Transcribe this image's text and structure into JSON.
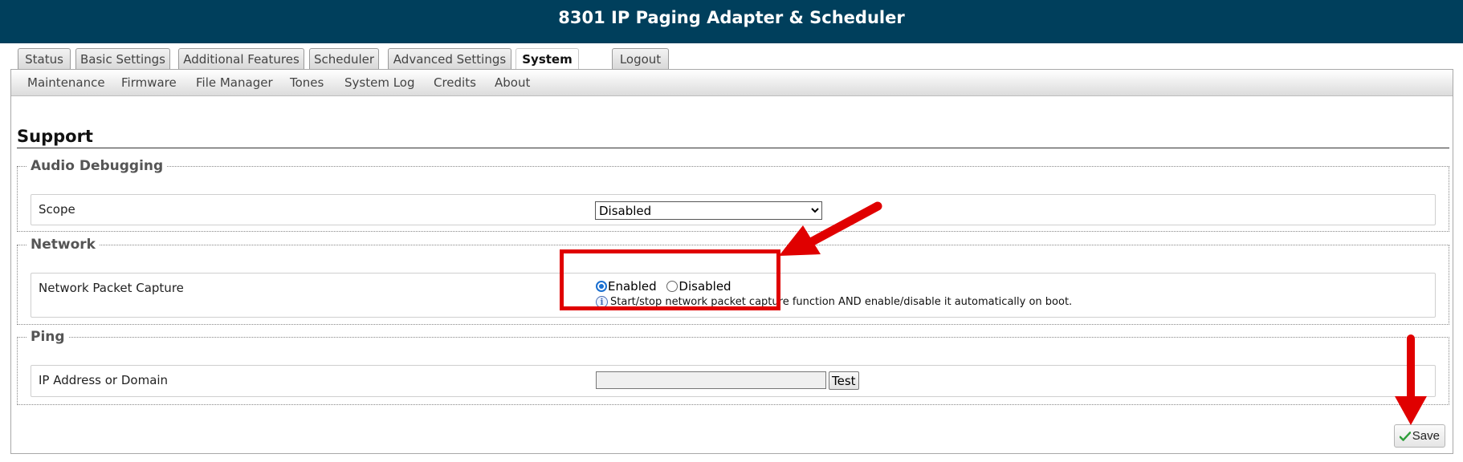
{
  "header": {
    "title": "8301 IP Paging Adapter & Scheduler"
  },
  "tabs": [
    {
      "label": "Status",
      "active": false
    },
    {
      "label": "Basic Settings",
      "active": false
    },
    {
      "label": "Additional Features",
      "active": false
    },
    {
      "label": "Scheduler",
      "active": false
    },
    {
      "label": "Advanced Settings",
      "active": false
    },
    {
      "label": "System",
      "active": true
    },
    {
      "label": "Logout",
      "active": false
    }
  ],
  "subnav": [
    "Maintenance",
    "Firmware",
    "File Manager",
    "Tones",
    "System Log",
    "Credits",
    "About"
  ],
  "page": {
    "title": "Support"
  },
  "audio_debugging": {
    "legend": "Audio Debugging",
    "scope_label": "Scope",
    "scope_value": "Disabled"
  },
  "network": {
    "legend": "Network",
    "capture_label": "Network Packet Capture",
    "option_enabled": "Enabled",
    "option_disabled": "Disabled",
    "selected": "Enabled",
    "help": "Start/stop network packet capture function AND enable/disable it automatically on boot."
  },
  "ping": {
    "legend": "Ping",
    "ip_label": "IP Address or Domain",
    "ip_value": "",
    "test_label": "Test"
  },
  "footer": {
    "save_label": "Save"
  },
  "colors": {
    "header_bg": "#003f5c",
    "annotation_red": "#e00000",
    "radio_accent": "#1a6fd0",
    "save_check": "#2e9e3a"
  },
  "icons": {
    "info": "info-icon",
    "save": "check-icon"
  }
}
